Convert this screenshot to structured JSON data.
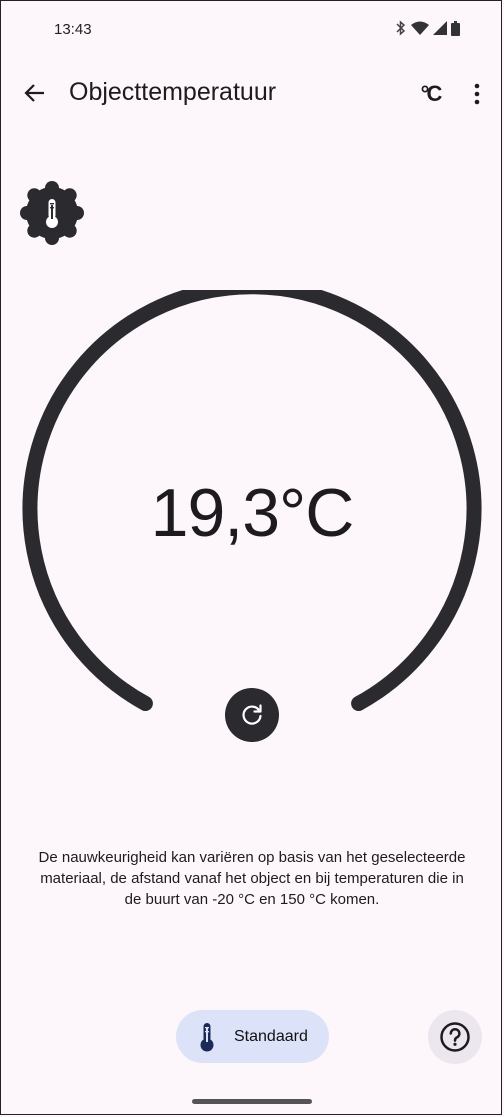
{
  "status_bar": {
    "time": "13:43",
    "icons": [
      "bluetooth-icon",
      "wifi-icon",
      "signal-icon",
      "battery-icon"
    ]
  },
  "app_bar": {
    "title": "Objecttemperatuur",
    "back_icon": "arrow-back-icon",
    "unit_toggle_label": "°C",
    "more_icon": "more-vert-icon"
  },
  "sensor_badge": {
    "icon": "thermometer-icon"
  },
  "gauge": {
    "reading": "19,3°C"
  },
  "refresh": {
    "icon": "refresh-icon"
  },
  "disclaimer": "De nauwkeurigheid kan variëren op basis van het geselecteerde materiaal, de afstand vanaf het object en bij temperaturen die in de buurt van -20 °C en 150 °C komen.",
  "mode_chip": {
    "label": "Standaard",
    "icon": "thermometer-icon"
  },
  "help": {
    "icon": "help-icon"
  },
  "colors": {
    "background": "#FDF7FB",
    "dial": "#2B2A2E",
    "chip": "#DCE3F8",
    "help_button": "#ECE6EE"
  }
}
